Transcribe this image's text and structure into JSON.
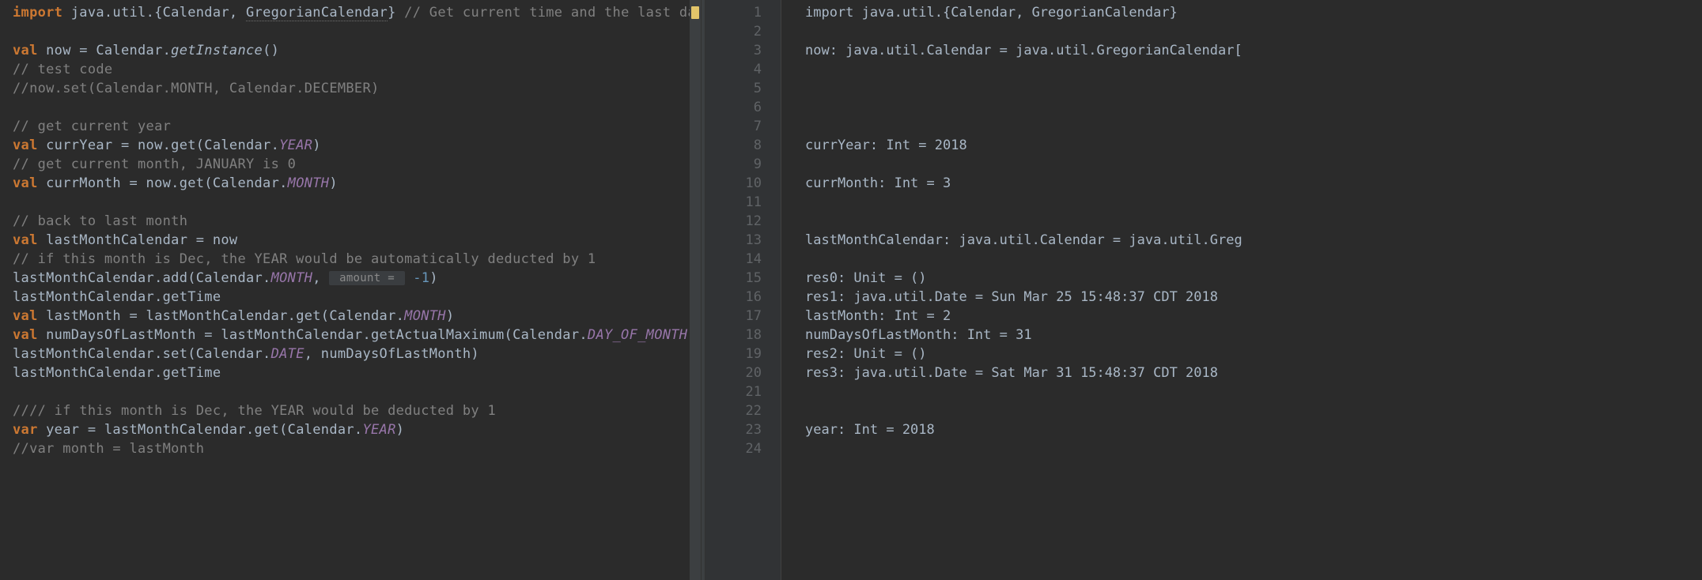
{
  "editor": {
    "lines": {
      "l1": {
        "import_kw": "import",
        "pkg": " java.util.{Calendar, ",
        "greg": "GregorianCalendar",
        "brace": "}",
        "comment": " // Get current time and the last date "
      },
      "l3": {
        "val": "val",
        "name": " now = Calendar.",
        "method": "getInstance",
        "after": "()"
      },
      "l4": "// test code",
      "l5": "//now.set(Calendar.MONTH, Calendar.DECEMBER)",
      "l7": "// get current year",
      "l8": {
        "val": "val",
        "name": " currYear = now.get(Calendar.",
        "const": "YEAR",
        "after": ")"
      },
      "l9": "// get current month, JANUARY is 0",
      "l10": {
        "val": "val",
        "name": " currMonth = now.get(Calendar.",
        "const": "MONTH",
        "after": ")"
      },
      "l12": "// back to last month",
      "l13": {
        "val": "val",
        "name": " lastMonthCalendar = now"
      },
      "l14": "// if this month is Dec, the YEAR would be automatically deducted by 1",
      "l15": {
        "pre": "lastMonthCalendar.add(Calendar.",
        "const": "MONTH",
        "comma": ", ",
        "hint": " amount = ",
        "sp": " ",
        "num": "-1",
        "close": ")"
      },
      "l16": "lastMonthCalendar.getTime",
      "l17": {
        "val": "val",
        "name": " lastMonth = lastMonthCalendar.get(Calendar.",
        "const": "MONTH",
        "after": ")"
      },
      "l18": {
        "val": "val",
        "name": " numDaysOfLastMonth = lastMonthCalendar.getActualMaximum(Calendar.",
        "const": "DAY_OF_MONTH",
        "after": ")"
      },
      "l19": {
        "pre": "lastMonthCalendar.set(Calendar.",
        "const": "DATE",
        "after": ", numDaysOfLastMonth)"
      },
      "l20": "lastMonthCalendar.getTime",
      "l22": "//// if this month is Dec, the YEAR would be deducted by 1",
      "l23": {
        "var": "var",
        "name": " year = lastMonthCalendar.get(Calendar.",
        "const": "YEAR",
        "after": ")"
      },
      "l24": "//var month = lastMonth"
    }
  },
  "gutter": {
    "n1": "1",
    "n2": "2",
    "n3": "3",
    "n4": "4",
    "n5": "5",
    "n6": "6",
    "n7": "7",
    "n8": "8",
    "n9": "9",
    "n10": "10",
    "n11": "11",
    "n12": "12",
    "n13": "13",
    "n14": "14",
    "n15": "15",
    "n16": "16",
    "n17": "17",
    "n18": "18",
    "n19": "19",
    "n20": "20",
    "n21": "21",
    "n22": "22",
    "n23": "23",
    "n24": "24"
  },
  "output": {
    "l1": "import java.util.{Calendar, GregorianCalendar}",
    "l3": "now: java.util.Calendar = java.util.GregorianCalendar[",
    "l8": "currYear: Int = 2018",
    "l10": "currMonth: Int = 3",
    "l13": "lastMonthCalendar: java.util.Calendar = java.util.Greg",
    "l15": "res0: Unit = ()",
    "l16": "res1: java.util.Date = Sun Mar 25 15:48:37 CDT 2018",
    "l17": "lastMonth: Int = 2",
    "l18": "numDaysOfLastMonth: Int = 31",
    "l19": "res2: Unit = ()",
    "l20": "res3: java.util.Date = Sat Mar 31 15:48:37 CDT 2018",
    "l23": "year: Int = 2018"
  }
}
